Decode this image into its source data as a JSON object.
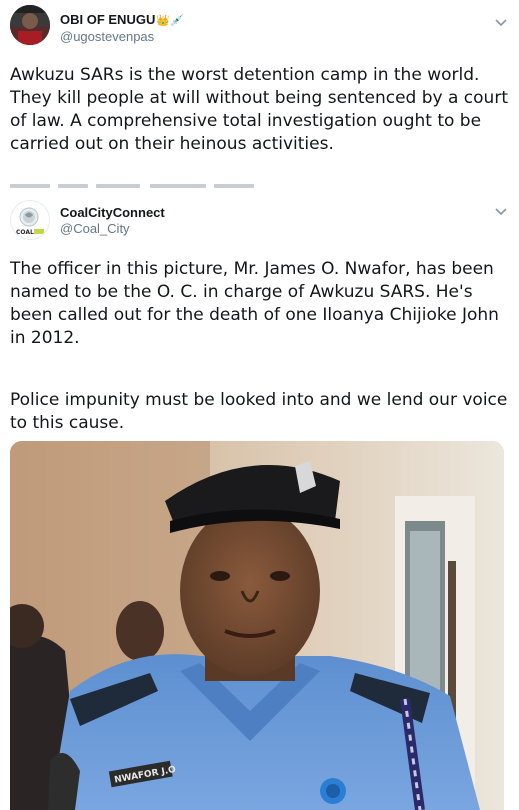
{
  "tweet1": {
    "display_name": "OBI OF ENUGU",
    "name_emojis": "👑💉",
    "handle": "@ugostevenpas",
    "text": "Awkuzu SARs is the worst detention camp in the world. They kill people at will without being sentenced by a court of law. A comprehensive total investigation ought to be carried out on their heinous activities.",
    "menu_icon": "chevron-down-icon"
  },
  "tweet2": {
    "display_name": "CoalCityConnect",
    "handle": "@Coal_City",
    "avatar_text": "COAL",
    "paragraph1": "The officer in this picture, Mr. James O. Nwafor, has been named to be the O. C. in charge of Awkuzu SARS. He's been called out for the death of one Iloanya Chijioke John in 2012.",
    "paragraph2": "Police impunity must be looked into and we lend our voice to this cause.",
    "menu_icon": "chevron-down-icon",
    "photo": {
      "name_tag": "NWAFOR J.O",
      "description_icon": "police-officer-photo"
    }
  },
  "colors": {
    "text": "#14171a",
    "secondary": "#657786",
    "uniform_blue": "#6a9ad8",
    "cap_black": "#1a1a1c"
  }
}
